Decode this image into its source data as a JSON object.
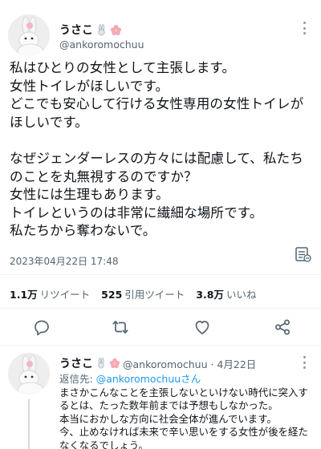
{
  "tweet": {
    "display_name": "うさこ",
    "handle": "@ankoromochuu",
    "name_emojis": [
      "rabbit-emoji",
      "flower-emoji"
    ],
    "text": "私はひとりの女性として主張します。\n女性トイレがほしいです。\nどこでも安心して行ける女性専用の女性トイレがほしいです。\n\nなぜジェンダーレスの方々には配慮して、私たちのことを丸無視するのですか？\n女性には生理もあります。\nトイレというのは非常に繊細な場所です。\n私たちから奪わないで。",
    "timestamp": "2023年04月22日 17:48",
    "stats": {
      "retweets_value": "1.1万",
      "retweets_label": "リツイート",
      "quotes_value": "525",
      "quotes_label": "引用ツイート",
      "likes_value": "3.8万",
      "likes_label": "いいね"
    },
    "actions": [
      "reply-icon",
      "retweet-icon",
      "like-icon",
      "share-icon"
    ]
  },
  "reply": {
    "display_name": "うさこ",
    "handle_date": "@ankoromochuu · 4月22日",
    "reply_to_prefix": "返信先:",
    "reply_to_user": "@ankoromochuuさん",
    "text": "まさかこんなことを主張しないといけない時代に突入するとは、たった数年前までは予想もしなかった。\n本当におかしな方向に社会全体が進んでいます。\n今、止めなければ未来で辛い思いをする女性が後を経たなくなるでしょう。"
  },
  "colors": {
    "text": "#0f1419",
    "muted": "#536471",
    "link": "#1d9bf0",
    "separator": "#eff3f4"
  }
}
